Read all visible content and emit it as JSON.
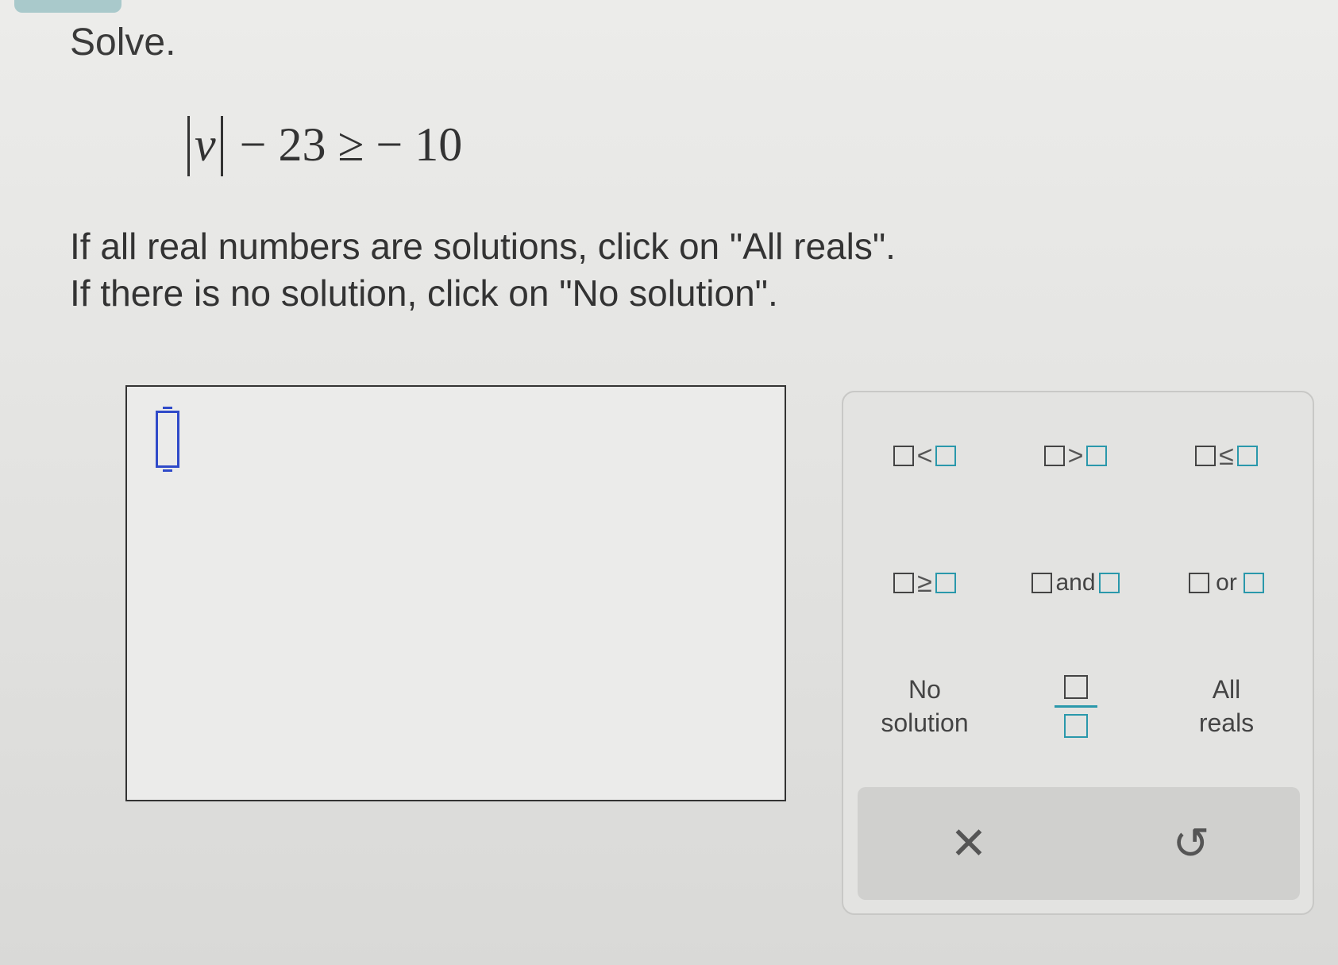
{
  "prompt": {
    "title": "Solve.",
    "equation": {
      "abs_var": "v",
      "rest": "− 23 ≥ − 10"
    },
    "instruction_line1": "If all real numbers are solutions, click on \"All reals\".",
    "instruction_line2": "If there is no solution, click on \"No solution\"."
  },
  "palette": {
    "lt_symbol": "<",
    "gt_symbol": ">",
    "le_symbol": "≤",
    "ge_symbol": "≥",
    "and_label": "and",
    "or_label": "or",
    "no_solution_line1": "No",
    "no_solution_line2": "solution",
    "all_reals_line1": "All",
    "all_reals_line2": "reals"
  },
  "actions": {
    "clear_glyph": "✕",
    "undo_glyph": "↺"
  },
  "colors": {
    "accent_teal": "#2a98ab",
    "cursor_blue": "#2f4ac9"
  }
}
